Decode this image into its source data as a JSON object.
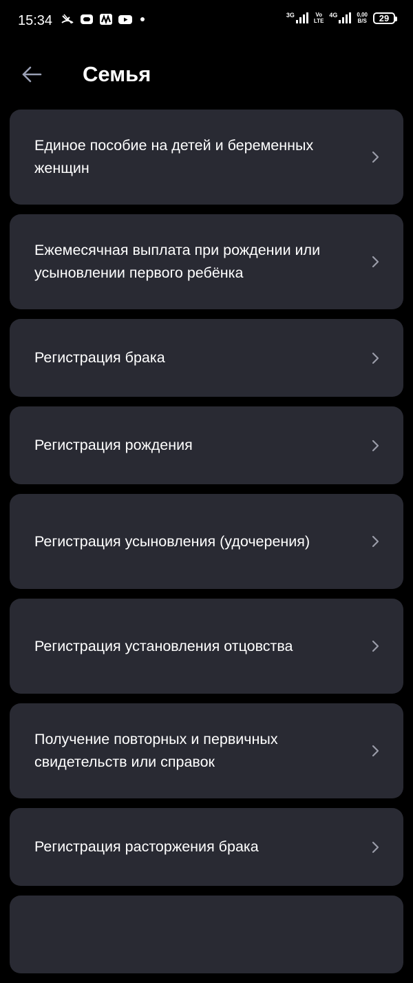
{
  "status_bar": {
    "time": "15:34",
    "network_1": "3G",
    "volte_top": "Vo",
    "volte_bottom": "LTE",
    "network_2": "4G",
    "speed_value": "0,00",
    "speed_unit": "B/S",
    "battery_level": "29",
    "left_icons": [
      "missed-call-icon",
      "notification-app-icon",
      "media-app-icon",
      "youtube-icon",
      "dot-icon"
    ]
  },
  "header": {
    "title": "Семья",
    "back_icon": "arrow-left-icon"
  },
  "colors": {
    "background": "#000000",
    "card": "#292a33",
    "text": "#ffffff",
    "chevron": "#9a9ca8"
  },
  "items": [
    {
      "label": "Единое пособие на детей и беременных женщин"
    },
    {
      "label": "Ежемесячная выплата при рождении или усыновлении первого ребёнка"
    },
    {
      "label": "Регистрация брака"
    },
    {
      "label": "Регистрация рождения"
    },
    {
      "label": "Регистрация усыновления (удочерения)"
    },
    {
      "label": "Регистрация установления отцовства"
    },
    {
      "label": "Получение повторных и первичных свидетельств или справок"
    },
    {
      "label": "Регистрация расторжения брака"
    },
    {
      "label": ""
    }
  ]
}
